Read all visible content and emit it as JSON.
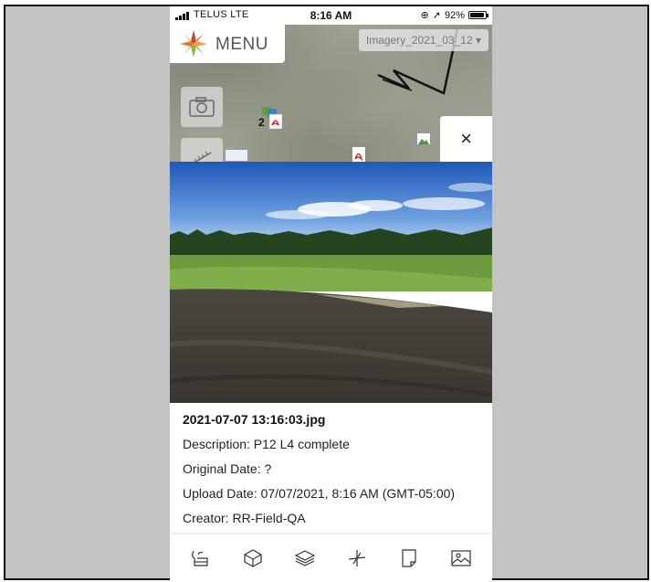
{
  "status_bar": {
    "carrier": "TELUS  LTE",
    "time": "8:16 AM",
    "battery": "92%",
    "battery_level": 0.92
  },
  "map": {
    "menu_label": "MENU",
    "imagery_layer": "Imagery_2021_03_12",
    "marker_badge": "2",
    "close_symbol": "×"
  },
  "photo": {
    "filename": "2021-07-07 13:16:03.jpg",
    "description": "Description: P12 L4 complete",
    "original_date": "Original Date: ?",
    "upload_date": "Upload Date: 07/07/2021, 8:16 AM (GMT-05:00)",
    "creator": "Creator: RR-Field-QA"
  },
  "toolbar": {
    "icons": [
      "sketch-icon",
      "cube-icon",
      "layers-icon",
      "measure-icon",
      "note-icon",
      "image-icon"
    ]
  },
  "colors": {
    "accent_red": "#d9412b",
    "accent_orange": "#f0a04b",
    "accent_green": "#8ab83b"
  }
}
